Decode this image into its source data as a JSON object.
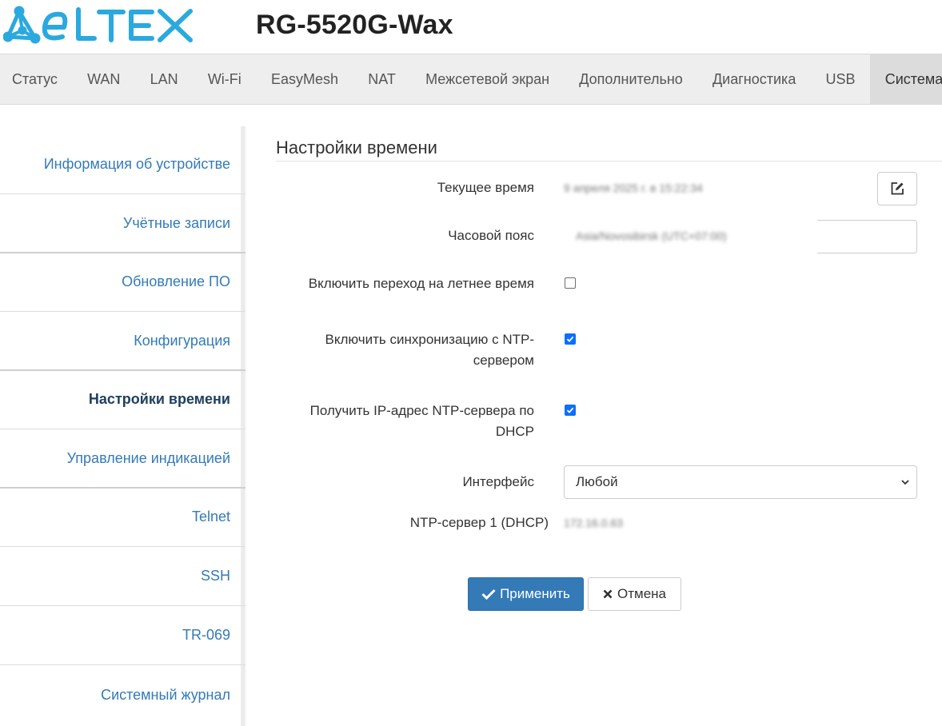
{
  "header": {
    "logo_text": "ELTEX",
    "model": "RG-5520G-Wax",
    "brand_color": "#2aa9df"
  },
  "topnav": {
    "tabs": [
      {
        "label": "Статус"
      },
      {
        "label": "WAN"
      },
      {
        "label": "LAN"
      },
      {
        "label": "Wi-Fi"
      },
      {
        "label": "EasyMesh"
      },
      {
        "label": "NAT"
      },
      {
        "label": "Межсетевой экран"
      },
      {
        "label": "Дополнительно"
      },
      {
        "label": "Диагностика"
      },
      {
        "label": "USB"
      },
      {
        "label": "Система",
        "active": true
      }
    ]
  },
  "sidebar": {
    "items": [
      {
        "label": "Информация об устройстве"
      },
      {
        "label": "Учётные записи"
      },
      {
        "label": "Обновление ПО"
      },
      {
        "label": "Конфигурация"
      },
      {
        "label": "Настройки времени",
        "active": true
      },
      {
        "label": "Управление индикацией"
      },
      {
        "label": "Telnet"
      },
      {
        "label": "SSH"
      },
      {
        "label": "TR-069"
      },
      {
        "label": "Системный журнал"
      }
    ]
  },
  "main": {
    "title": "Настройки времени",
    "current_time": {
      "label": "Текущее время",
      "value": "9 апреля 2025 г. в 15:22:34",
      "edit_icon": "edit-icon"
    },
    "timezone": {
      "label": "Часовой пояс",
      "value": "Asia/Novosibirsk (UTC+07:00)"
    },
    "dst": {
      "label": "Включить переход на летнее время",
      "checked": false
    },
    "ntp_sync": {
      "label_line1": "Включить синхронизацию с NTP-",
      "label_line2": "сервером",
      "checked": true
    },
    "ntp_dhcp": {
      "label_line1": "Получить IP-адрес NTP-сервера по",
      "label_line2": "DHCP",
      "checked": true
    },
    "interface": {
      "label": "Интерфейс",
      "selected": "Любой"
    },
    "ntp_server1": {
      "label": "NTP-сервер 1 (DHCP)",
      "value": "172.16.0.63"
    },
    "buttons": {
      "apply": "Применить",
      "cancel": "Отмена"
    }
  },
  "colors": {
    "link": "#337ab7",
    "active_link": "#1f3f60",
    "primary_button": "#337ab7",
    "checkbox_checked": "#0d6efd",
    "nav_bg": "#eeeeee"
  }
}
